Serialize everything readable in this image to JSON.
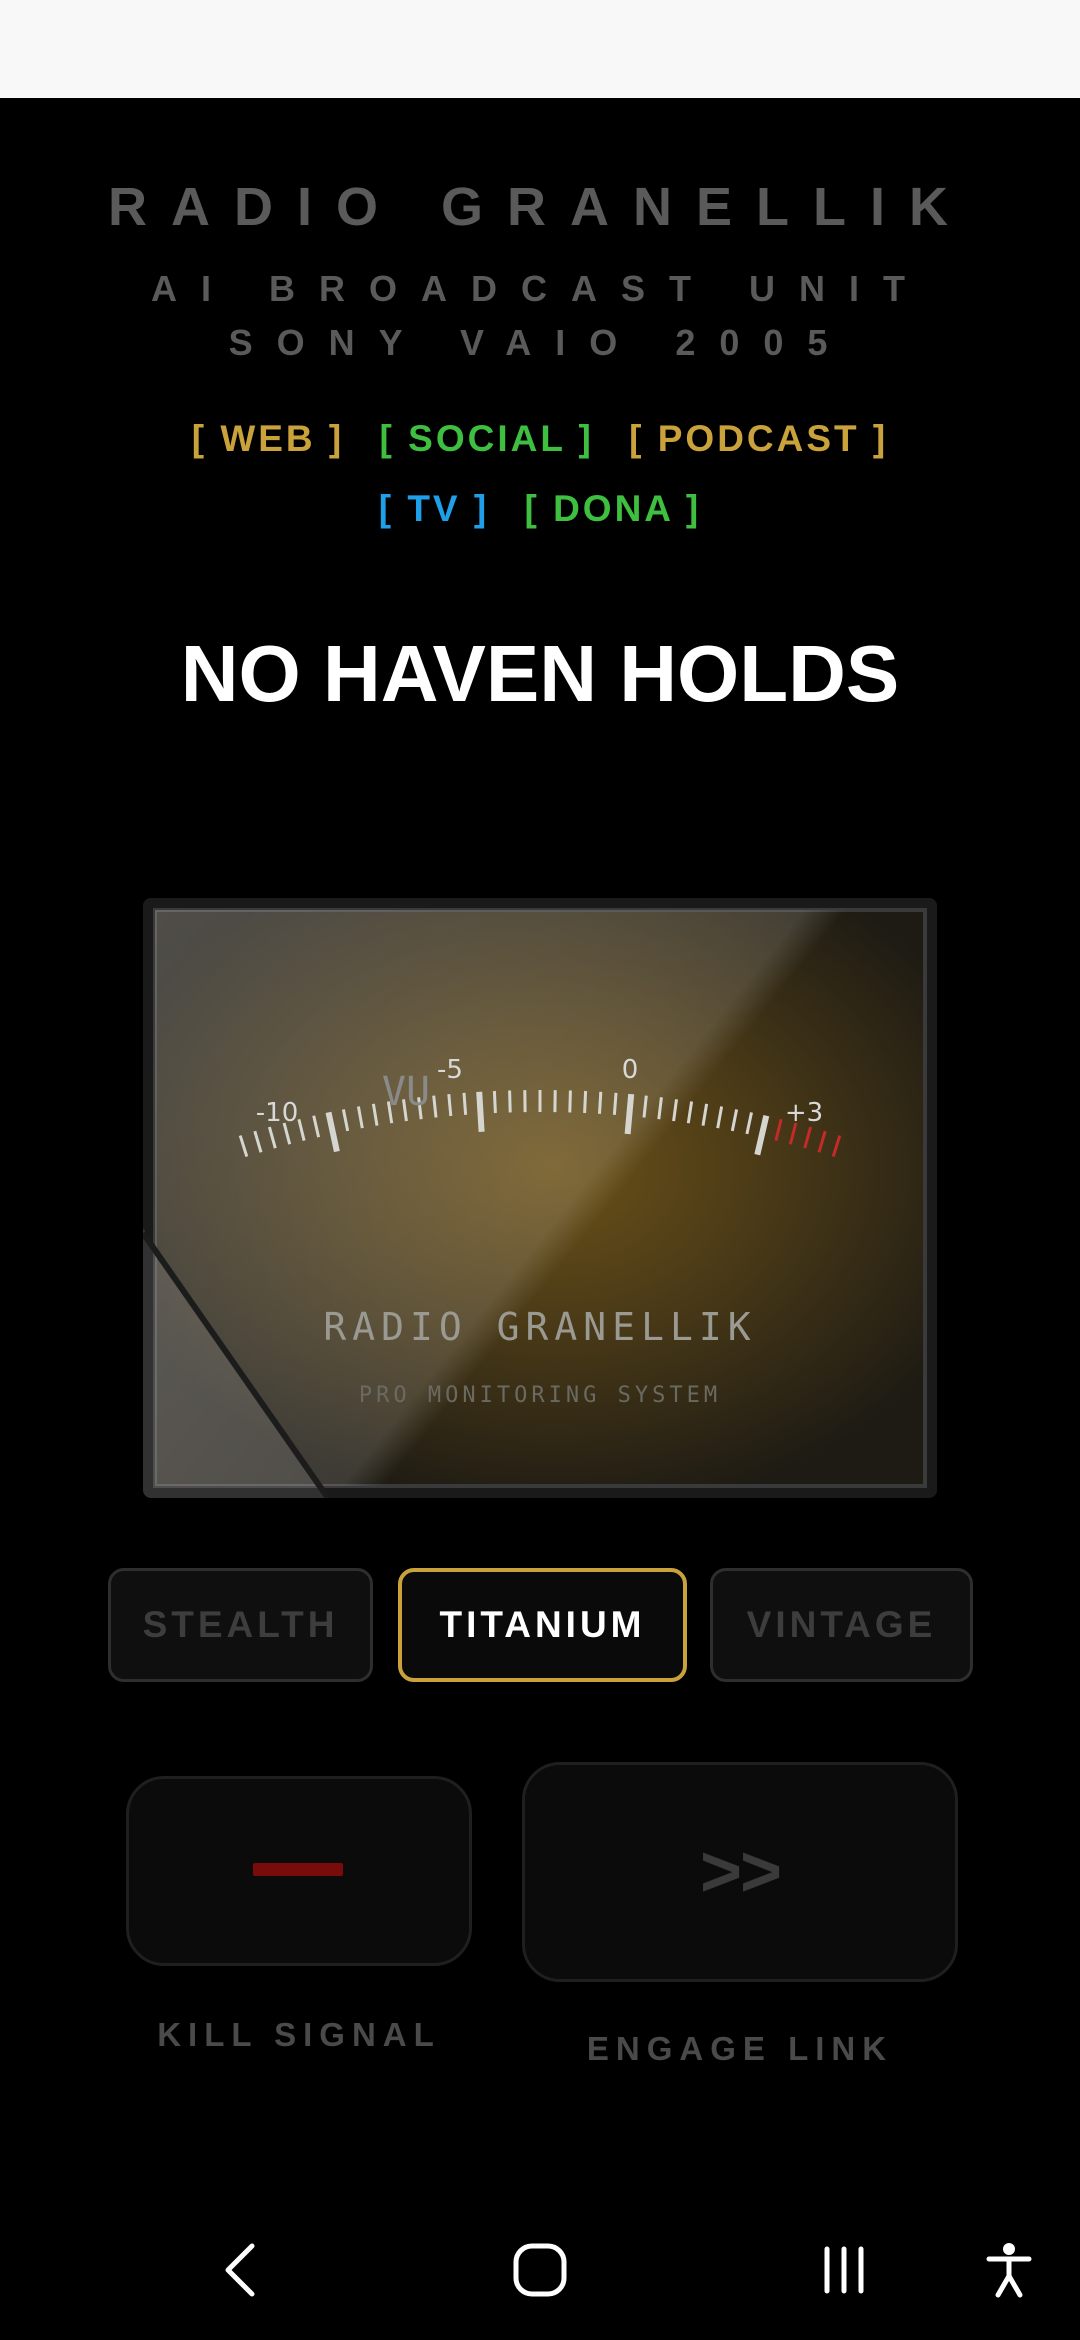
{
  "header": {
    "title": "RADIO GRANELLIK",
    "subtitle_line1": "AI BROADCAST UNIT",
    "subtitle_line2": "SONY VAIO 2005"
  },
  "links": [
    {
      "label": "[ WEB ]",
      "color": "#c9a23c"
    },
    {
      "label": "[ SOCIAL ]",
      "color": "#3fbf3f"
    },
    {
      "label": "[ PODCAST ]",
      "color": "#c9a23c"
    },
    {
      "label": "[ TV ]",
      "color": "#1e9fe8"
    },
    {
      "label": "[ DONA ]",
      "color": "#3fbf3f"
    }
  ],
  "now_playing": "NO HAVEN HOLDS",
  "meter": {
    "scale_label": "VU",
    "tick_labels": [
      "-10",
      "-5",
      "0",
      "+3"
    ],
    "brand": "RADIO GRANELLIK",
    "tagline": "PRO MONITORING SYSTEM"
  },
  "modes": {
    "items": [
      "STEALTH",
      "TITANIUM",
      "VINTAGE"
    ],
    "selected": "TITANIUM"
  },
  "controls": {
    "kill_label": "KILL SIGNAL",
    "engage_label": "ENGAGE LINK",
    "engage_glyph": ">>",
    "kill_color": "#7a0b0b"
  },
  "colors": {
    "accent": "#c9a23c",
    "background": "#000000"
  }
}
